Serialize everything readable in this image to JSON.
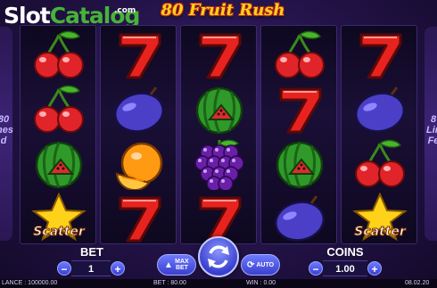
{
  "watermark": {
    "brand_a": "Slot",
    "brand_b": "Catalog",
    "tld": ".com"
  },
  "game": {
    "title": "80 Fruit Rush"
  },
  "side_panels": {
    "left_text": "80\nnes\nd",
    "right_text": "8\nLin\nFe"
  },
  "reels": [
    [
      "cherry",
      "cherry",
      "watermelon",
      "scatter"
    ],
    [
      "seven",
      "plum",
      "orange",
      "seven"
    ],
    [
      "seven",
      "watermelon",
      "grapes",
      "seven"
    ],
    [
      "cherry",
      "seven",
      "watermelon",
      "plum"
    ],
    [
      "seven",
      "plum",
      "cherry",
      "scatter"
    ]
  ],
  "symbols": {
    "scatter_label": "Scatter"
  },
  "controls": {
    "bet_label": "BET",
    "bet_value": "1",
    "coins_label": "COINS",
    "coins_value": "1.00",
    "minus": "−",
    "plus": "+",
    "max_bet_label": "MAX BET",
    "auto_label": "AUTO"
  },
  "status_bar": {
    "balance": "LANCE : 100000.00",
    "bet": "BET : 80.00",
    "win": "WIN : 0.00",
    "clock": "08.02.20"
  },
  "colors": {
    "cherry": "#e0242a",
    "seven": "#e8231f",
    "plum": "#4b3fc8",
    "watermelon": "#2f9a2a",
    "orange": "#ff9a12",
    "grapes": "#6a1fa8",
    "scatter": "#ffd21a",
    "accent": "#4a52e0"
  }
}
